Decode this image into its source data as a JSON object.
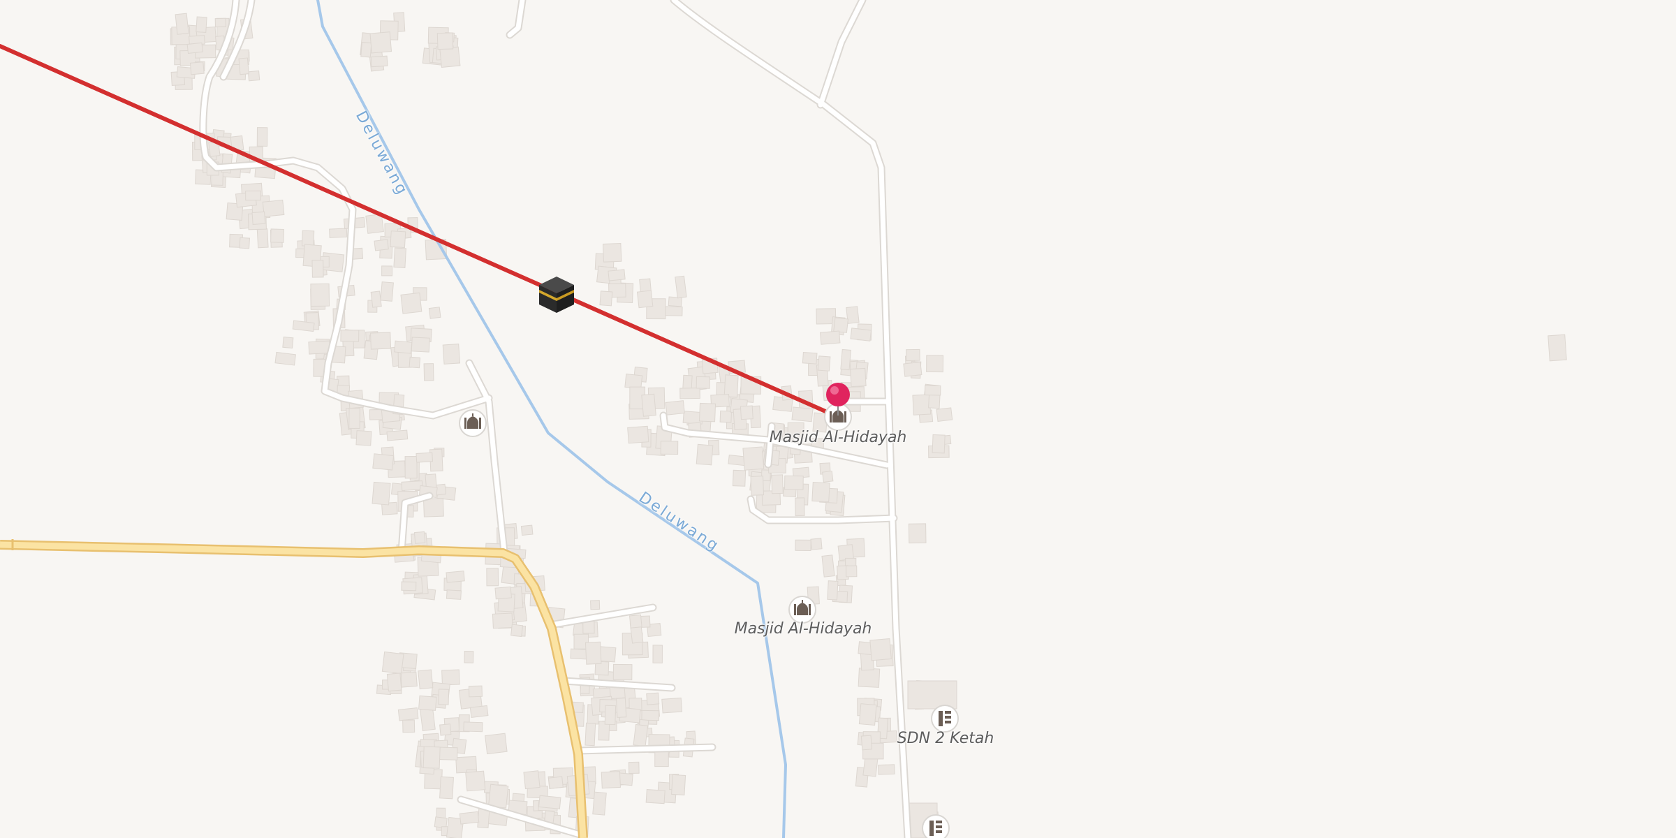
{
  "map": {
    "colors": {
      "background": "#f8f6f3",
      "building": "#ebe6e1",
      "road": "#ffffff",
      "road_casing": "#dcd8d3",
      "main_road": "#fbe3a3",
      "main_road_casing": "#e8c06f",
      "river": "#a6c8ea",
      "qibla_line": "#d32f2f",
      "pin": "#e0245e"
    },
    "pois": [
      {
        "name": "mosque",
        "icon": "mosque-icon",
        "label": ""
      },
      {
        "name": "mosque-selected",
        "icon": "mosque-icon",
        "label": "Masjid Al-Hidayah"
      },
      {
        "name": "mosque-2",
        "icon": "mosque-icon",
        "label": "Masjid Al-Hidayah"
      },
      {
        "name": "school",
        "icon": "school-icon",
        "label": "SDN 2 Ketah"
      },
      {
        "name": "school-2",
        "icon": "school-icon",
        "label": ""
      }
    ],
    "rivers": [
      {
        "name": "Deluwang"
      },
      {
        "name": "Deluwang"
      }
    ],
    "qibla": {
      "icon": "kaaba-icon",
      "line": "qibla-direction-line"
    },
    "marker": {
      "icon": "location-pin-icon"
    }
  }
}
